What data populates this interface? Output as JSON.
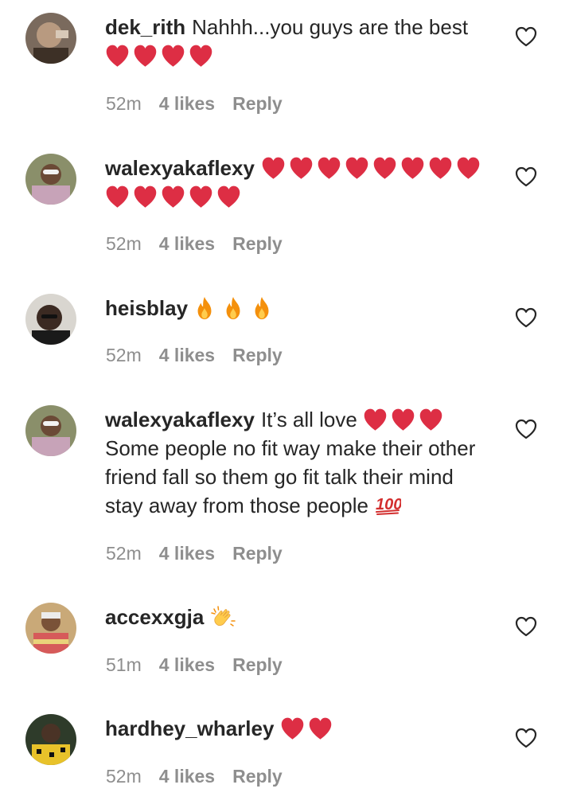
{
  "comments": [
    {
      "username": "dek_rith",
      "text": "Nahhh...you guys are the best",
      "emoji": "❤️❤️❤️❤️",
      "time": "52m",
      "likes": "4 likes",
      "reply": "Reply",
      "avatar": "avatar-photo"
    },
    {
      "username": "walexyakaflexy",
      "text": "",
      "emoji": "❤️❤️❤️❤️❤️❤️❤️❤️❤️❤️❤️❤️❤️",
      "time": "52m",
      "likes": "4 likes",
      "reply": "Reply",
      "avatar": "avatar-photo"
    },
    {
      "username": "heisblay",
      "text": "",
      "emoji": "🔥🔥🔥",
      "time": "52m",
      "likes": "4 likes",
      "reply": "Reply",
      "avatar": "avatar-photo"
    },
    {
      "username": "walexyakaflexy",
      "text_before_emoji": "It’s all love",
      "emoji": "❤️❤️❤️",
      "text": "Some people no fit way make their other friend fall so them go fit talk their mind stay away from those people",
      "emoji_after": "💯",
      "time": "52m",
      "likes": "4 likes",
      "reply": "Reply",
      "avatar": "avatar-photo"
    },
    {
      "username": "accexxgja",
      "text": "",
      "emoji": "👏",
      "time": "51m",
      "likes": "4 likes",
      "reply": "Reply",
      "avatar": "avatar-photo"
    },
    {
      "username": "hardhey_wharley",
      "text": "",
      "emoji": "❤️❤️",
      "time": "52m",
      "likes": "4 likes",
      "reply": "Reply",
      "avatar": "avatar-photo"
    }
  ],
  "icons": {
    "like": "heart-outline-icon",
    "avatar": "profile-avatar-icon"
  },
  "colors": {
    "username": "#262626",
    "text": "#262626",
    "meta": "#8e8e8e",
    "heart_emoji": "#dd2e44",
    "background": "#ffffff"
  }
}
